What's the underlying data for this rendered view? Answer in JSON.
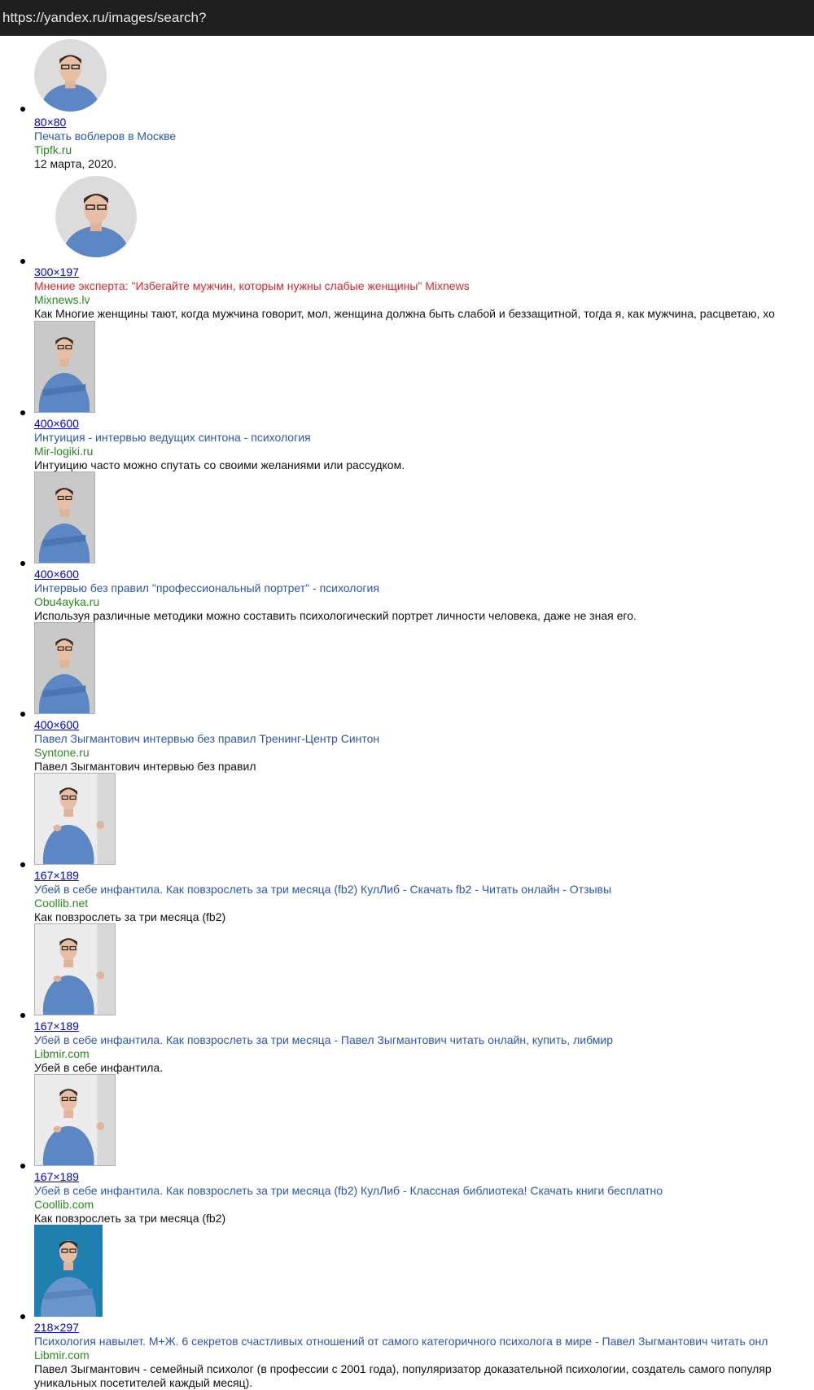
{
  "url": "https://yandex.ru/images/search?",
  "colors": {
    "link": "#2c56ae",
    "link_red": "#d9262e",
    "domain": "#2a8a1d",
    "size_link": "#0000cc",
    "urlbar_bg": "#1f1f1f"
  },
  "results": [
    {
      "size": "80×80",
      "title": "Печать воблеров в Москве",
      "domain": "Tipfk.ru",
      "description": "12 марта, 2020."
    },
    {
      "size": "300×197",
      "title": "Мнение эксперта: \"Избегайте мужчин, которым нужны слабые женщины\" Mixnews",
      "domain": "Mixnews.lv",
      "description": "Как Многие женщины тают, когда мужчина говорит, мол, женщина должна быть слабой и беззащитной, тогда я, как мужчина, расцветаю, хо"
    },
    {
      "size": "400×600",
      "title": "Интуиция - интервью ведущих синтона - психология",
      "domain": "Mir-logiki.ru",
      "description": "Интуицию часто можно спутать со своими желаниями или рассудком."
    },
    {
      "size": "400×600",
      "title": "Интервью без правил \"профессиональный портрет\" - психология",
      "domain": "Obu4ayka.ru",
      "description": "Используя различные методики можно составить психологический портрет личности человека, даже не зная его."
    },
    {
      "size": "400×600",
      "title": "Павел Зыгмантович интервью без правил Тренинг-Центр Синтон",
      "domain": "Syntone.ru",
      "description": "Павел Зыгмантович интервью без правил"
    },
    {
      "size": "167×189",
      "title": "Убей в себе инфантила. Как повзрослеть за три месяца (fb2) КулЛиб - Скачать fb2 - Читать онлайн - Отзывы",
      "domain": "Coollib.net",
      "description": "Как повзрослеть за три месяца (fb2)"
    },
    {
      "size": "167×189",
      "title": "Убей в себе инфантила. Как повзрослеть за три месяца - Павел Зыгмантович читать онлайн, купить, либмир",
      "domain": "Libmir.com",
      "description": "Убей в себе инфантила."
    },
    {
      "size": "167×189",
      "title": "Убей в себе инфантила. Как повзрослеть за три месяца (fb2) КулЛиб - Классная библиотека! Скачать книги бесплатно",
      "domain": "Coollib.com",
      "description": "Как повзрослеть за три месяца (fb2)"
    },
    {
      "size": "218×297",
      "title": "Психология навылет. М+Ж. 6 секретов счастливых отношений от самого категоричного психолога в мире - Павел Зыгмантович читать онл",
      "domain": "Libmir.com",
      "description": "Павел Зыгмантович - семейный психолог (в профессии с 2001 года), популяризатор доказательной психологии, создатель самого популяр уникальных посетителей каждый месяц)."
    }
  ]
}
